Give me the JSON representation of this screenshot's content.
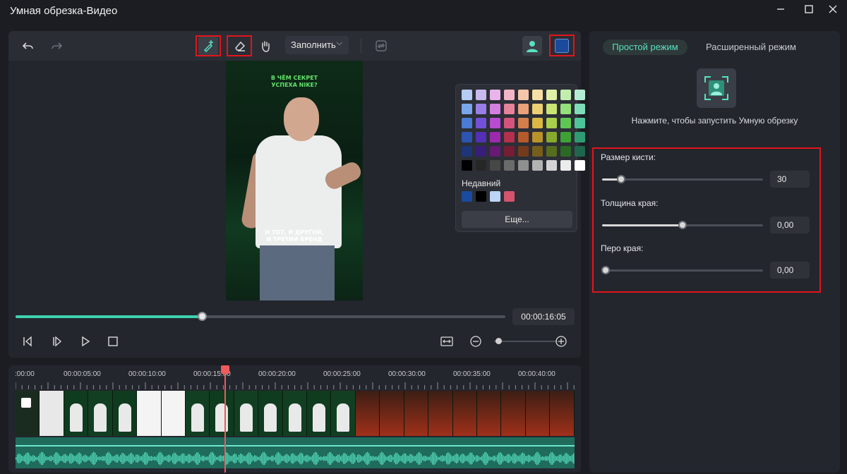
{
  "window": {
    "title": "Умная обрезка-Видео"
  },
  "toolbar": {
    "fill_mode": "Заполнить",
    "accent_color": "#1a4a9c"
  },
  "video": {
    "top_text_line1": "В ЧЁМ СЕКРЕТ",
    "top_text_line2": "УСПЕХА NIKE?",
    "bottom_text_line1": "И ТОТ, И ДРУГОЙ,",
    "bottom_text_line2": "И ТРЕТИЙ БРЕНД"
  },
  "color_picker": {
    "recent_label": "Недавний",
    "more_label": "Еще...",
    "palette": [
      [
        "#b5cdf4",
        "#c9b8f0",
        "#e9b4ec",
        "#f2b6c8",
        "#f5c6aa",
        "#f6e0a6",
        "#dff0a8",
        "#c1eeae",
        "#b3ecd3"
      ],
      [
        "#7aa6ea",
        "#9a7ee6",
        "#d47ee0",
        "#e7829d",
        "#eba079",
        "#edcf73",
        "#c9e375",
        "#94e07b",
        "#7fdcb9"
      ],
      [
        "#4a7bd6",
        "#7350d9",
        "#b94ad2",
        "#d4547b",
        "#d57e4b",
        "#dbb744",
        "#a9d14a",
        "#5fc653",
        "#4ec39a"
      ],
      [
        "#2d55b0",
        "#5330b5",
        "#9b2aad",
        "#b3304f",
        "#b65a2c",
        "#b9922a",
        "#86a92e",
        "#3ea136",
        "#2e9b74"
      ],
      [
        "#1c3678",
        "#371e7a",
        "#661a74",
        "#751d33",
        "#753a1b",
        "#775f1b",
        "#566d1e",
        "#2a6a24",
        "#1e664c"
      ],
      [
        "#000000",
        "#262626",
        "#474747",
        "#6b6b6b",
        "#8f8f8f",
        "#b3b3b3",
        "#d4d4d4",
        "#ececec",
        "#ffffff"
      ]
    ],
    "recent": [
      "#1a4a9c",
      "#000000",
      "#bcd4f6",
      "#d4546e"
    ]
  },
  "playback": {
    "timecode": "00:00:16:05",
    "progress_percent": 38
  },
  "timeline": {
    "ticks": [
      ":00:00",
      "00:00:05:00",
      "00:00:10:00",
      "00:00:15:00",
      "00:00:20:00",
      "00:00:25:00",
      "00:00:30:00",
      "00:00:35:00",
      "00:00:40:00"
    ]
  },
  "panel": {
    "tab_simple": "Простой режим",
    "tab_advanced": "Расширенный режим",
    "hint": "Нажмите, чтобы запустить Умную обрезку",
    "brush_size_label": "Размер кисти:",
    "brush_size_value": "30",
    "brush_size_percent": 12,
    "edge_thickness_label": "Толщина края:",
    "edge_thickness_value": "0,00",
    "edge_thickness_percent": 50,
    "edge_feather_label": "Перо края:",
    "edge_feather_value": "0,00",
    "edge_feather_percent": 2
  }
}
